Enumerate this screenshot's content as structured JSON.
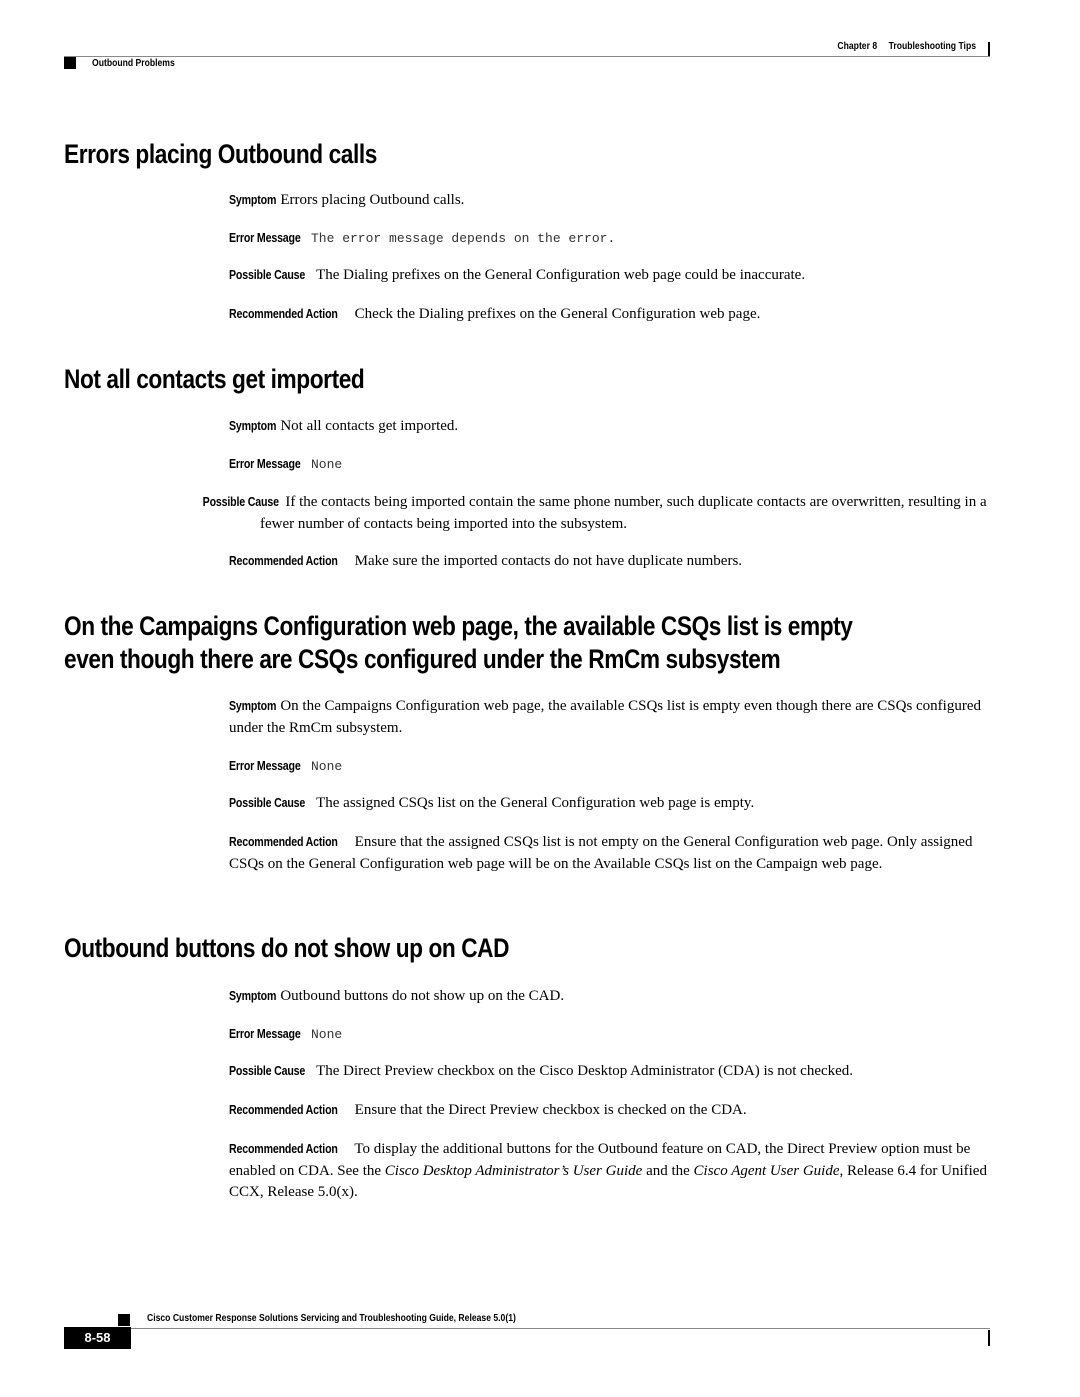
{
  "header": {
    "chapter": "Chapter 8",
    "chapter_title": "Troubleshooting Tips",
    "section": "Outbound Problems"
  },
  "sections": [
    {
      "title": "Errors placing Outbound calls",
      "entries": [
        {
          "label": "Symptom",
          "text": "Errors placing Outbound calls."
        },
        {
          "label": "Error Message",
          "code": "The error message depends on the error."
        },
        {
          "label": "Possible Cause",
          "text": "The Dialing prefixes on the General Configuration web page could be inaccurate."
        },
        {
          "label": "Recommended Action",
          "text": "Check the Dialing prefixes on the General Configuration web page."
        }
      ]
    },
    {
      "title": "Not all contacts get imported",
      "entries": [
        {
          "label": "Symptom",
          "text": "Not all contacts get imported."
        },
        {
          "label": "Error Message",
          "code": "None"
        },
        {
          "label": "Possible Cause",
          "text": "If the contacts being imported contain the same phone number, such duplicate contacts are overwritten, resulting in a fewer number of contacts being imported into the subsystem."
        },
        {
          "label": "Recommended Action",
          "text": "Make sure the imported contacts do not have duplicate numbers."
        }
      ]
    },
    {
      "title_line1": "On the Campaigns Configuration web page, the available CSQs list is empty",
      "title_line2": "even though there are CSQs configured under the RmCm subsystem",
      "entries": [
        {
          "label": "Symptom",
          "text": "On the Campaigns Configuration web page, the available CSQs list is empty even though there are CSQs configured under the RmCm subsystem."
        },
        {
          "label": "Error Message",
          "code": "None"
        },
        {
          "label": "Possible Cause",
          "text": "The assigned CSQs list on the General Configuration web page is empty."
        },
        {
          "label": "Recommended Action",
          "text": "Ensure that the assigned CSQs list is not empty on the General Configuration web page. Only assigned CSQs on the General Configuration web page will be on the Available CSQs list on the Campaign web page."
        }
      ]
    },
    {
      "title": "Outbound buttons do not show up on CAD",
      "entries": [
        {
          "label": "Symptom",
          "text": "Outbound buttons do not show up on the CAD."
        },
        {
          "label": "Error Message",
          "code": "None"
        },
        {
          "label": "Possible Cause",
          "text": "The Direct Preview checkbox on the Cisco Desktop Administrator (CDA) is not checked."
        },
        {
          "label": "Recommended Action",
          "text": "Ensure that the Direct Preview checkbox is checked on the CDA."
        },
        {
          "label": "Recommended Action",
          "text_a": "To display the additional buttons for the Outbound feature on CAD, the Direct Preview option must be enabled on CDA. See the ",
          "ref1": "Cisco Desktop Administrator’s User Guide",
          "text_b": " and the ",
          "ref2": "Cisco Agent User Guide",
          "text_c": ", Release 6.4 for Unified CCX, Release 5.0(x)."
        }
      ]
    }
  ],
  "footer": {
    "title": "Cisco Customer Response Solutions Servicing and Troubleshooting Guide, Release 5.0(1)",
    "page_number": "8-58"
  }
}
